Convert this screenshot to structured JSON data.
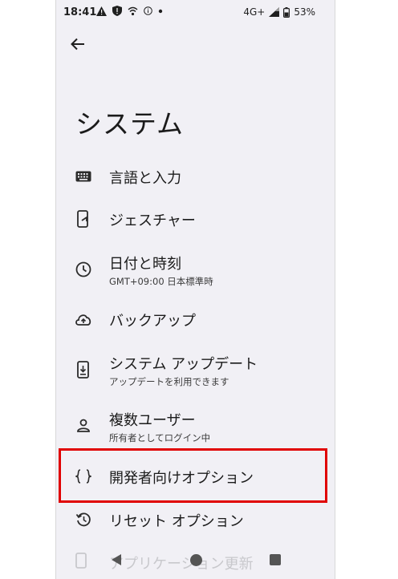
{
  "status_bar": {
    "time": "18:41",
    "network": "4G+",
    "battery": "53%"
  },
  "header": {
    "title": "システム"
  },
  "settings": {
    "items": [
      {
        "title": "言語と入力",
        "subtitle": "",
        "icon": "keyboard-icon"
      },
      {
        "title": "ジェスチャー",
        "subtitle": "",
        "icon": "phone-gesture-icon"
      },
      {
        "title": "日付と時刻",
        "subtitle": "GMT+09:00 日本標準時",
        "icon": "clock-icon"
      },
      {
        "title": "バックアップ",
        "subtitle": "",
        "icon": "cloud-upload-icon"
      },
      {
        "title": "システム アップデート",
        "subtitle": "アップデートを利用できます",
        "icon": "system-update-icon"
      },
      {
        "title": "複数ユーザー",
        "subtitle": "所有者としてログイン中",
        "icon": "person-icon"
      },
      {
        "title": "開発者向けオプション",
        "subtitle": "",
        "icon": "code-braces-icon"
      },
      {
        "title": "リセット オプション",
        "subtitle": "",
        "icon": "reset-history-icon"
      }
    ]
  },
  "overlay": {
    "ghost_text": "アプリケーション更新"
  },
  "colors": {
    "highlight": "#e00000",
    "background": "#f1f0f5"
  }
}
